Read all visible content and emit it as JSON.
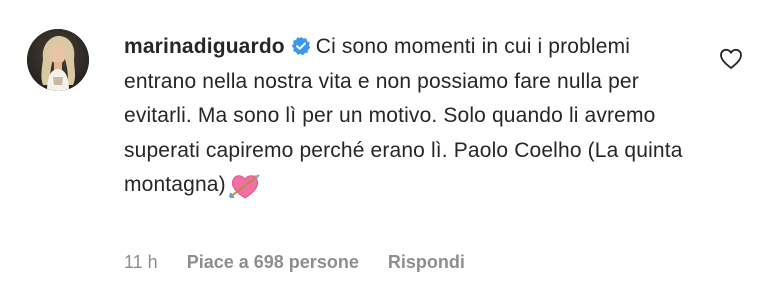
{
  "comment": {
    "username": "marinadiguardo",
    "verified": true,
    "text": "Ci sono momenti in cui i problemi entrano nella nostra vita e non possiamo fare nulla per evitarli. Ma sono lì per un motivo. Solo quando li avremo superati capiremo perché erano lì. Paolo Coelho (La quinta montagna)",
    "emoji": "heart-with-arrow-emoji",
    "timestamp": "11 h",
    "likes_label": "Piace a 698 persone",
    "reply_label": "Rispondi",
    "like_icon": "heart-outline-icon"
  },
  "colors": {
    "text": "#262626",
    "meta": "#8e8e8e",
    "verified_badge": "#3897f0"
  }
}
